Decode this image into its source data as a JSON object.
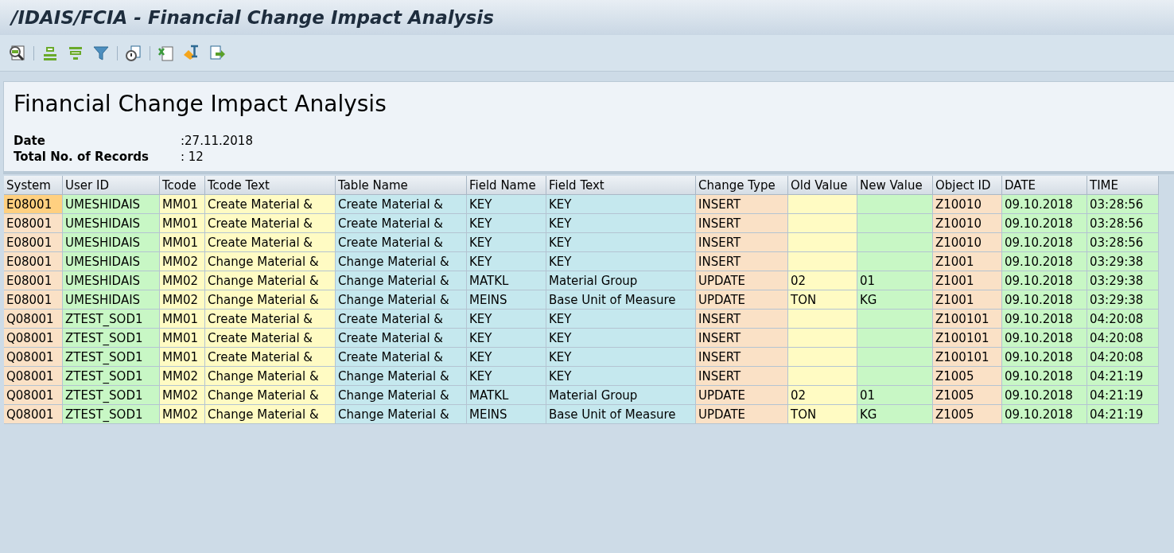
{
  "window": {
    "title": "/IDAIS/FCIA - Financial Change Impact Analysis"
  },
  "header": {
    "title": "Financial Change Impact Analysis",
    "fields": [
      {
        "label": "Date",
        "value": ":27.11.2018"
      },
      {
        "label": "Total No. of Records",
        "value": ": 12"
      }
    ]
  },
  "table": {
    "columns": [
      {
        "label": "System",
        "color": "#fae1c6"
      },
      {
        "label": "User ID",
        "color": "#c8f7c5"
      },
      {
        "label": "Tcode",
        "color": "#fffbc3"
      },
      {
        "label": "Tcode Text",
        "color": "#fffbc3"
      },
      {
        "label": "Table Name",
        "color": "#c5e8ee"
      },
      {
        "label": "Field Name",
        "color": "#c5e8ee"
      },
      {
        "label": "Field Text",
        "color": "#c5e8ee"
      },
      {
        "label": "Change Type",
        "color": "#fae1c6"
      },
      {
        "label": "Old Value",
        "color": "#fffbc3"
      },
      {
        "label": "New Value",
        "color": "#c8f7c5"
      },
      {
        "label": "Object ID",
        "color": "#fae1c6"
      },
      {
        "label": "DATE",
        "color": "#c8f7c5"
      },
      {
        "label": "TIME",
        "color": "#c8f7c5"
      }
    ],
    "rows": [
      {
        "selected": true,
        "cells": [
          "E08001",
          "UMESHIDAIS",
          "MM01",
          "Create Material &",
          "Create Material &",
          "KEY",
          "KEY",
          "INSERT",
          "",
          "",
          "Z10010",
          "09.10.2018",
          "03:28:56"
        ]
      },
      {
        "selected": false,
        "cells": [
          "E08001",
          "UMESHIDAIS",
          "MM01",
          "Create Material &",
          "Create Material &",
          "KEY",
          "KEY",
          "INSERT",
          "",
          "",
          "Z10010",
          "09.10.2018",
          "03:28:56"
        ]
      },
      {
        "selected": false,
        "cells": [
          "E08001",
          "UMESHIDAIS",
          "MM01",
          "Create Material &",
          "Create Material &",
          "KEY",
          "KEY",
          "INSERT",
          "",
          "",
          "Z10010",
          "09.10.2018",
          "03:28:56"
        ]
      },
      {
        "selected": false,
        "cells": [
          "E08001",
          "UMESHIDAIS",
          "MM02",
          "Change Material &",
          "Change Material &",
          "KEY",
          "KEY",
          "INSERT",
          "",
          "",
          "Z1001",
          "09.10.2018",
          "03:29:38"
        ]
      },
      {
        "selected": false,
        "cells": [
          "E08001",
          "UMESHIDAIS",
          "MM02",
          "Change Material &",
          "Change Material &",
          "MATKL",
          "Material Group",
          "UPDATE",
          "02",
          "01",
          "Z1001",
          "09.10.2018",
          "03:29:38"
        ]
      },
      {
        "selected": false,
        "cells": [
          "E08001",
          "UMESHIDAIS",
          "MM02",
          "Change Material &",
          "Change Material &",
          "MEINS",
          "Base Unit of Measure",
          "UPDATE",
          "TON",
          "KG",
          "Z1001",
          "09.10.2018",
          "03:29:38"
        ]
      },
      {
        "selected": false,
        "cells": [
          "Q08001",
          "ZTEST_SOD1",
          "MM01",
          "Create Material &",
          "Create Material &",
          "KEY",
          "KEY",
          "INSERT",
          "",
          "",
          "Z100101",
          "09.10.2018",
          "04:20:08"
        ]
      },
      {
        "selected": false,
        "cells": [
          "Q08001",
          "ZTEST_SOD1",
          "MM01",
          "Create Material &",
          "Create Material &",
          "KEY",
          "KEY",
          "INSERT",
          "",
          "",
          "Z100101",
          "09.10.2018",
          "04:20:08"
        ]
      },
      {
        "selected": false,
        "cells": [
          "Q08001",
          "ZTEST_SOD1",
          "MM01",
          "Create Material &",
          "Create Material &",
          "KEY",
          "KEY",
          "INSERT",
          "",
          "",
          "Z100101",
          "09.10.2018",
          "04:20:08"
        ]
      },
      {
        "selected": false,
        "cells": [
          "Q08001",
          "ZTEST_SOD1",
          "MM02",
          "Change Material &",
          "Change Material &",
          "KEY",
          "KEY",
          "INSERT",
          "",
          "",
          "Z1005",
          "09.10.2018",
          "04:21:19"
        ]
      },
      {
        "selected": false,
        "cells": [
          "Q08001",
          "ZTEST_SOD1",
          "MM02",
          "Change Material &",
          "Change Material &",
          "MATKL",
          "Material Group",
          "UPDATE",
          "02",
          "01",
          "Z1005",
          "09.10.2018",
          "04:21:19"
        ]
      },
      {
        "selected": false,
        "cells": [
          "Q08001",
          "ZTEST_SOD1",
          "MM02",
          "Change Material &",
          "Change Material &",
          "MEINS",
          "Base Unit of Measure",
          "UPDATE",
          "TON",
          "KG",
          "Z1005",
          "09.10.2018",
          "04:21:19"
        ]
      }
    ]
  }
}
